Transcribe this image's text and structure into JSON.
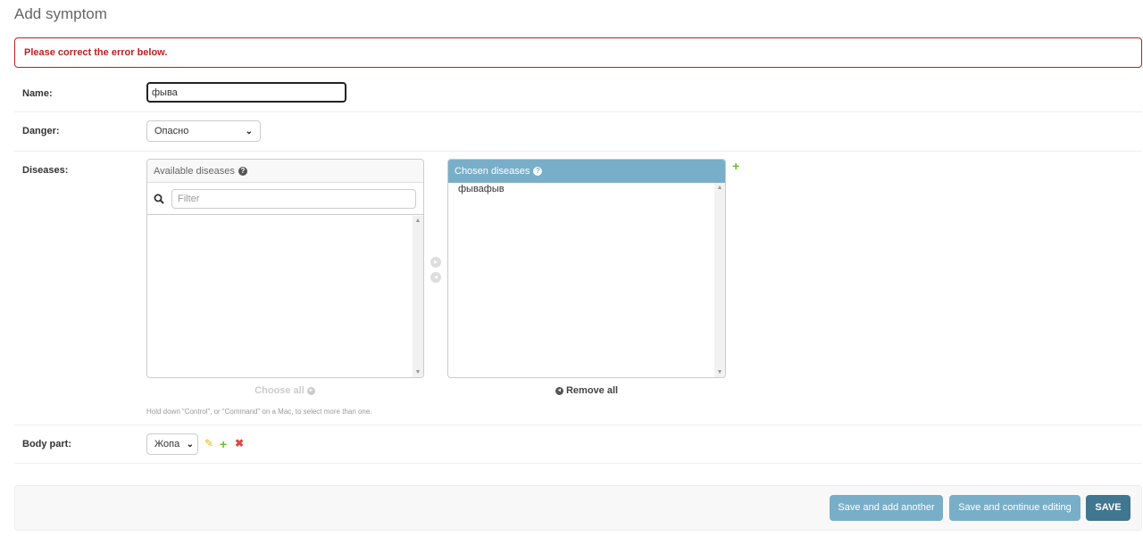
{
  "page": {
    "title": "Add symptom"
  },
  "error": {
    "message": "Please correct the error below."
  },
  "form": {
    "name": {
      "label": "Name:",
      "value": "фыва"
    },
    "danger": {
      "label": "Danger:",
      "selected": "Опасно"
    },
    "diseases": {
      "label": "Diseases:",
      "available_title": "Available diseases",
      "filter_placeholder": "Filter",
      "available_options": [],
      "chosen_title": "Chosen diseases",
      "chosen_options": [
        "фывафыв"
      ],
      "choose_all": "Choose all",
      "remove_all": "Remove all",
      "help": "Hold down “Control”, or “Command” on a Mac, to select more than one."
    },
    "body_part": {
      "label": "Body part:",
      "selected": "Жопа"
    }
  },
  "buttons": {
    "save_add_another": "Save and add another",
    "save_continue": "Save and continue editing",
    "save": "SAVE"
  },
  "colors": {
    "error": "#ba2121",
    "header_blue": "#79aec8",
    "primary_button": "#417690",
    "add_icon": "#70bf2b",
    "edit_icon": "#efb80b",
    "delete_icon": "#dd4646"
  },
  "icons": {
    "help": "question-circle-icon",
    "search": "magnifier-icon",
    "add": "plus-icon",
    "edit": "pencil-icon",
    "delete": "x-icon"
  }
}
